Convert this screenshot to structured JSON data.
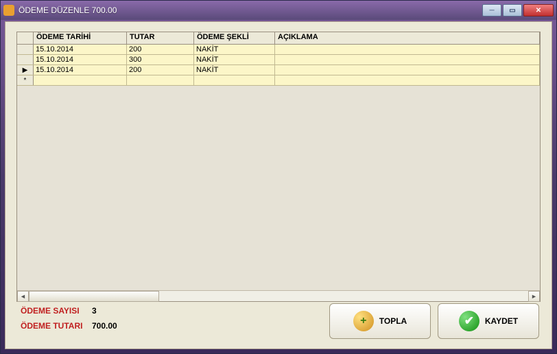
{
  "window": {
    "title": "ÖDEME DÜZENLE 700.00"
  },
  "grid": {
    "headers": {
      "date": "ÖDEME TARİHİ",
      "amount": "TUTAR",
      "method": "ÖDEME ŞEKLİ",
      "desc": "AÇIKLAMA"
    },
    "rows": [
      {
        "marker": "",
        "date": "15.10.2014",
        "amount": "200",
        "method": "NAKİT",
        "desc": ""
      },
      {
        "marker": "",
        "date": "15.10.2014",
        "amount": "300",
        "method": "NAKİT",
        "desc": ""
      },
      {
        "marker": "▶",
        "date": "15.10.2014",
        "amount": "200",
        "method": "NAKİT",
        "desc": ""
      },
      {
        "marker": "*",
        "date": "",
        "amount": "",
        "method": "",
        "desc": ""
      }
    ]
  },
  "summary": {
    "count_label": "ÖDEME SAYISI",
    "count_value": "3",
    "total_label": "ÖDEME TUTARI",
    "total_value": "700.00"
  },
  "buttons": {
    "topla": "TOPLA",
    "kaydet": "KAYDET"
  }
}
